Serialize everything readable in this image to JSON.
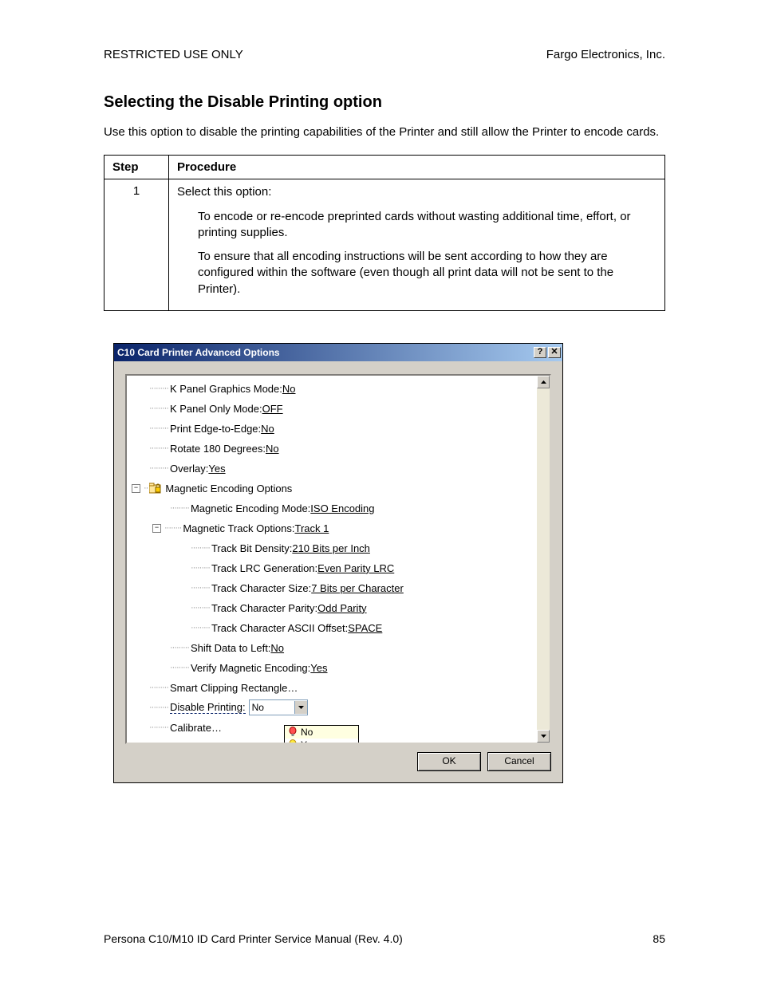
{
  "header": {
    "left": "RESTRICTED USE ONLY",
    "right": "Fargo Electronics, Inc."
  },
  "heading": "Selecting the Disable Printing option",
  "intro": "Use this option to disable the printing capabilities of the Printer and still allow the Printer to encode cards.",
  "table": {
    "col1": "Step",
    "col2": "Procedure",
    "step_num": "1",
    "p1": "Select this option:",
    "p2": "To encode or re-encode preprinted cards without wasting additional time, effort, or printing supplies.",
    "p3": "To ensure that all encoding instructions will be sent according to how they are configured within the software (even though all print data will not be sent to the Printer)."
  },
  "dialog": {
    "title": "C10 Card Printer Advanced Options",
    "help_btn": "?",
    "close_btn": "✕",
    "tree": {
      "r1_label": "K Panel Graphics Mode: ",
      "r1_val": "No",
      "r2_label": "K Panel Only Mode: ",
      "r2_val": "OFF",
      "r3_label": "Print Edge-to-Edge: ",
      "r3_val": "No",
      "r4_label": "Rotate 180 Degrees: ",
      "r4_val": "No",
      "r5_label": "Overlay: ",
      "r5_val": "Yes",
      "r6_label": "Magnetic Encoding Options",
      "r7_label": "Magnetic Encoding Mode: ",
      "r7_val": "ISO Encoding",
      "r8_label": "Magnetic Track Options: ",
      "r8_val": "Track 1",
      "r9_label": "Track Bit Density: ",
      "r9_val": "210 Bits per Inch",
      "r10_label": "Track LRC Generation: ",
      "r10_val": "Even Parity LRC",
      "r11_label": "Track Character Size: ",
      "r11_val": "7 Bits per Character",
      "r12_label": "Track Character Parity: ",
      "r12_val": "Odd Parity",
      "r13_label": "Track Character ASCII Offset: ",
      "r13_val": "SPACE",
      "r14_label": "Shift Data to Left: ",
      "r14_val": "No",
      "r15_label": "Verify Magnetic Encoding: ",
      "r15_val": "Yes",
      "r16_label": "Smart Clipping Rectangle…",
      "r17_label": "Disable Printing:",
      "r17_selected": "No",
      "r17_opt_no": "No",
      "r17_opt_yes": "Yes",
      "r18_label": "Calibrate…"
    },
    "ok": "OK",
    "cancel": "Cancel"
  },
  "footer": {
    "left": "Persona C10/M10 ID Card Printer Service Manual (Rev. 4.0)",
    "right": "85"
  }
}
